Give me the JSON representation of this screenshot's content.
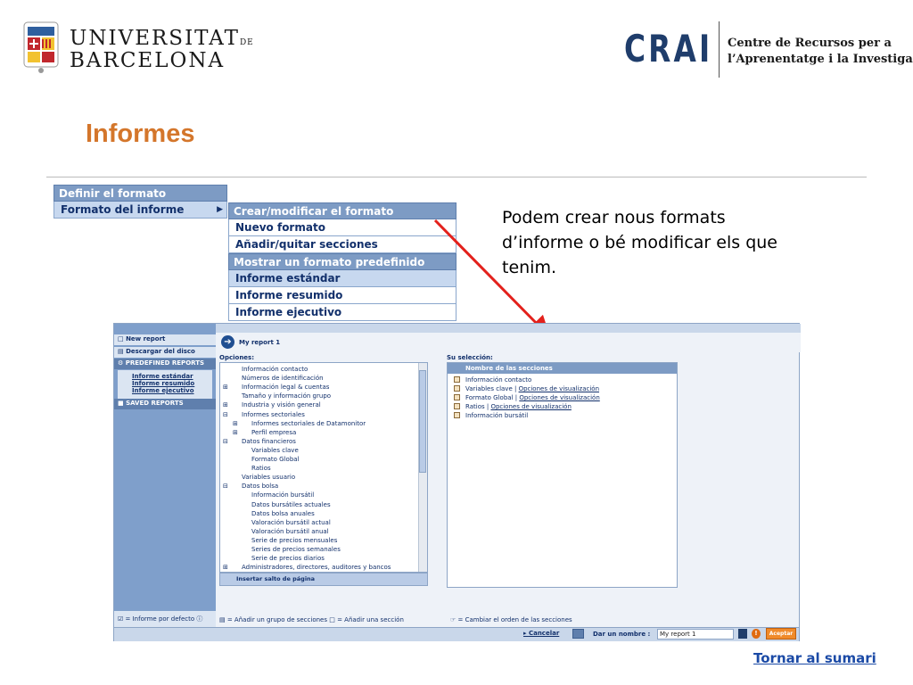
{
  "header": {
    "university_line1": "UNIVERSITAT",
    "university_de": "DE",
    "university_line2": "BARCELONA",
    "crai_mark": "CRAI",
    "crai_text_line1": "Centre de Recursos per a",
    "crai_text_line2": "l’Aprenentatge i la Investigació"
  },
  "page_title": "Informes",
  "menu1": {
    "header": "Definir el formato",
    "item": "Formato del informe"
  },
  "menu2": {
    "header1": "Crear/modificar el formato",
    "items1": [
      "Nuevo formato",
      "Añadir/quitar secciones"
    ],
    "header2": "Mostrar un formato predefinido",
    "items2": [
      "Informe estándar",
      "Informe resumido",
      "Informe ejecutivo"
    ]
  },
  "callout": "Podem crear nous formats d’informe o bé modificar els que tenim.",
  "app": {
    "sidebar": {
      "new_report": "New report",
      "download": "Descargar del disco",
      "predefined": "PREDEFINED REPORTS",
      "predefined_items": [
        "Informe estándar",
        "Informe resumido",
        "Informe ejecutivo"
      ],
      "saved": "SAVED REPORTS",
      "default_legend": "= Informe por defecto"
    },
    "report_name": "My report 1",
    "options_label": "Opciones:",
    "options_tree": [
      "Información contacto",
      "Números de identificación",
      "Información legal & cuentas",
      "Tamaño y información grupo",
      "Industria y visión general",
      "Informes sectoriales",
      "Informes sectoriales de Datamonitor",
      "Perfil empresa",
      "Datos financieros",
      "Variables clave",
      "Formato Global",
      "Ratios",
      "Variables usuario",
      "Datos bolsa",
      "Información bursátil",
      "Datos bursátiles actuales",
      "Datos bolsa anuales",
      "Valoración bursátil actual",
      "Valoración bursátil anual",
      "Serie de precios mensuales",
      "Series de precios semanales",
      "Serie de precios diarios",
      "Administradores, directores, auditores y bancos"
    ],
    "page_break": "Insertar salto de página",
    "selection_label": "Su selección:",
    "selection_header": "Nombre de las secciones",
    "selection_rows": [
      {
        "text": "Información contacto",
        "link": ""
      },
      {
        "text": "Variables clave | ",
        "link": "Opciones de visualización"
      },
      {
        "text": "Formato Global | ",
        "link": "Opciones de visualización"
      },
      {
        "text": "Ratios | ",
        "link": "Opciones de visualización"
      },
      {
        "text": "Información bursátil",
        "link": ""
      }
    ],
    "legend_left": "= Añadir un grupo de secciones",
    "legend_mid": "= Añadir una sección",
    "legend_right": "= Cambiar el orden de las secciones",
    "cancel": "Cancelar",
    "name_label": "Dar un nombre :",
    "name_value": "My report 1",
    "accept": "Aceptar"
  },
  "back_link": "Tornar al sumari",
  "colors": {
    "title": "#d4762b",
    "menu_header": "#7d9bc4",
    "menu_item": "#c7d8ef",
    "crai": "#1f3d6b",
    "arrow": "#e3211c",
    "link": "#1b4aa6"
  }
}
